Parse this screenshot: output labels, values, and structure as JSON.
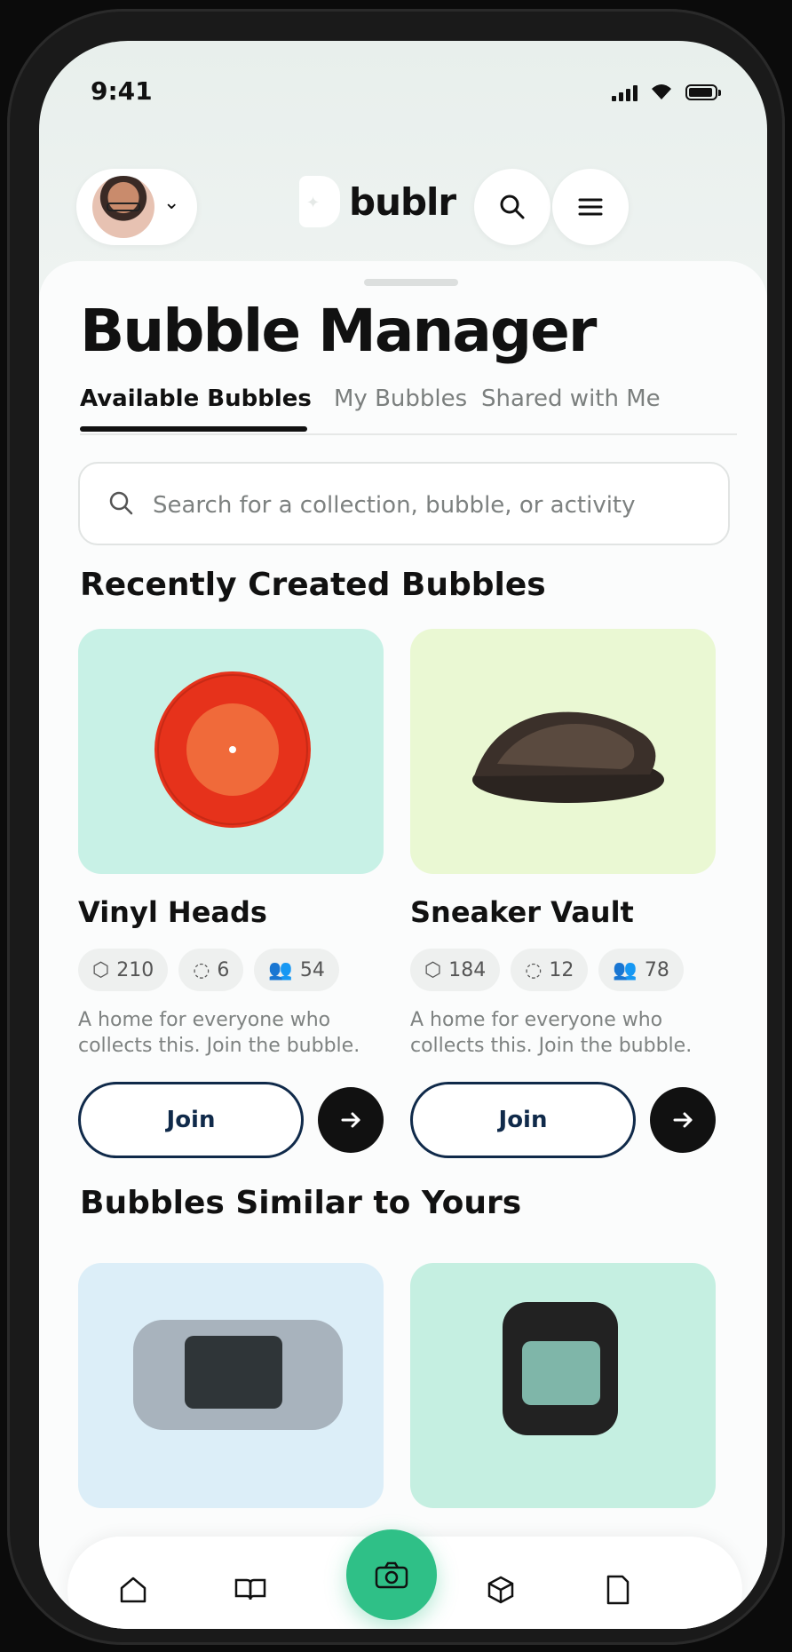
{
  "status_bar": {
    "time": "9:41"
  },
  "header": {
    "logo": "bublr",
    "avatar_alt": "User avatar",
    "chevron_icon": "chevron-down-icon",
    "search_icon": "search-icon",
    "menu_icon": "menu-icon"
  },
  "page": {
    "title": "Bubble Manager"
  },
  "tabs": [
    {
      "label": "Available Bubbles",
      "active": true
    },
    {
      "label": "My Bubbles",
      "active": false
    },
    {
      "label": "Shared with Me",
      "active": false
    }
  ],
  "search": {
    "placeholder": "Search for a collection, bubble, or activity"
  },
  "sections": {
    "recent": "Recently Created Bubbles",
    "similar": "Bubbles Similar to Yours"
  },
  "cards": [
    {
      "name": "Vinyl Heads",
      "items": "210",
      "comments": "6",
      "members": "54",
      "description": "A home for everyone who collects this. Join the bubble.",
      "button": "Join",
      "bg": "#c8f1e6"
    },
    {
      "name": "Sneaker Vault",
      "items": "184",
      "comments": "12",
      "members": "78",
      "description": "A home for everyone who collects this. Join the bubble.",
      "button": "Join",
      "bg": "#eaf8d3"
    }
  ],
  "similar_cards": [
    {
      "bg": "#dceef8"
    },
    {
      "bg": "#c5efe1"
    }
  ],
  "bottom_nav": [
    {
      "icon": "home-icon"
    },
    {
      "icon": "book-icon"
    },
    {
      "icon": "camera-icon"
    },
    {
      "icon": "cube-icon"
    },
    {
      "icon": "document-icon"
    }
  ],
  "colors": {
    "accent": "#2fc087",
    "text_primary": "#111111",
    "join_border": "#102a4a"
  }
}
